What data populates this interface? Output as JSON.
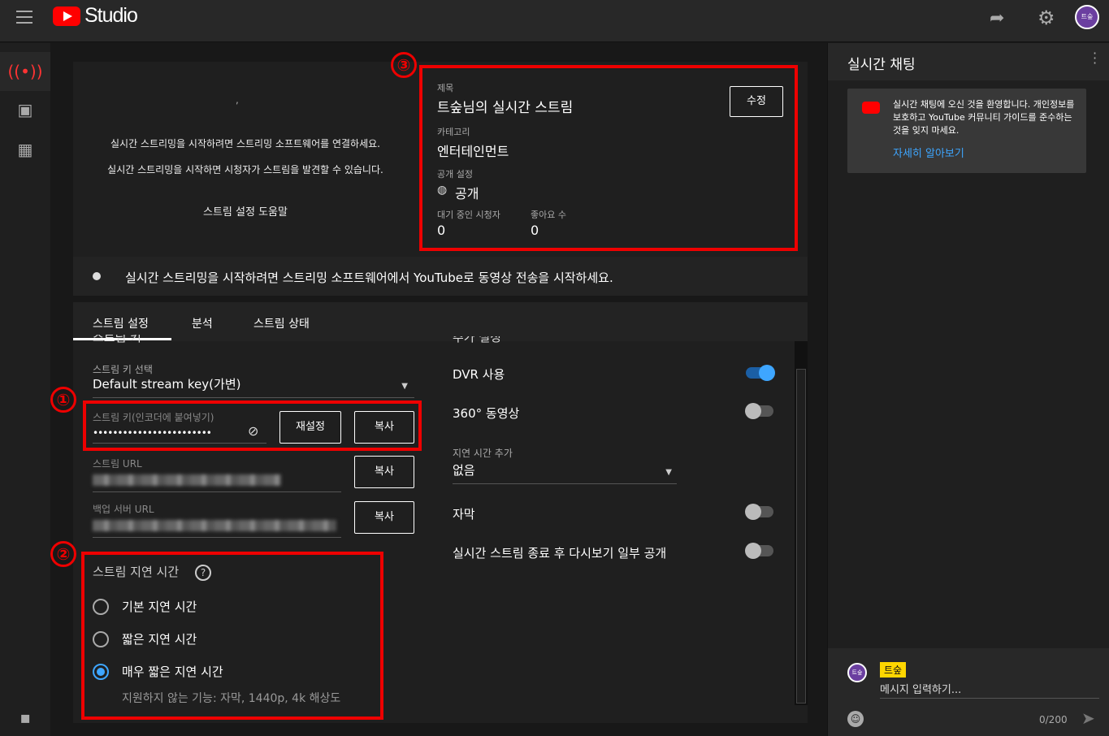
{
  "header": {
    "brand": "Studio",
    "avatar_initials": "트숲"
  },
  "preview": {
    "line1": "실시간 스트리밍을 시작하려면 스트리밍 소프트웨어를 연결하세요.",
    "line2": "실시간 스트리밍을 시작하면 시청자가 스트림을 발견할 수 있습니다.",
    "help_link": "스트림 설정 도움말"
  },
  "info": {
    "title_label": "제목",
    "title_value": "트숲님의 실시간 스트림",
    "edit_button": "수정",
    "category_label": "카테고리",
    "category_value": "엔터테인먼트",
    "visibility_label": "공개 설정",
    "visibility_value": "공개",
    "waiting_label": "대기 중인 시청자",
    "waiting_value": "0",
    "likes_label": "좋아요 수",
    "likes_value": "0"
  },
  "banner": {
    "text": "실시간 스트리밍을 시작하려면 스트리밍 소프트웨어에서 YouTube로 동영상 전송을 시작하세요."
  },
  "tabs": [
    "스트림 설정",
    "분석",
    "스트림 상태"
  ],
  "stream_key": {
    "section_cut": "스트림 키",
    "select_label": "스트림 키 선택",
    "select_value": "Default stream key(가변)",
    "key_label": "스트림 키(인코더에 붙여넣기)",
    "key_value": "••••••••••••••••••••••••",
    "reset_button": "재설정",
    "copy_button": "복사",
    "url_label": "스트림 URL",
    "backup_label": "백업 서버 URL"
  },
  "latency": {
    "title": "스트림 지연 시간",
    "options": [
      "기본 지연 시간",
      "짧은 지연 시간",
      "매우 짧은 지연 시간"
    ],
    "selected_index": 2,
    "note": "지원하지 않는 기능: 자막, 1440p, 4k 해상도"
  },
  "additional": {
    "section_cut": "추가 설정",
    "dvr": "DVR 사용",
    "dvr_on": true,
    "vr360": "360° 동영상",
    "vr360_on": false,
    "delay_label": "지연 시간 추가",
    "delay_value": "없음",
    "captions": "자막",
    "captions_on": false,
    "replay": "실시간 스트림 종료 후 다시보기 일부 공개",
    "replay_on": false
  },
  "annotations": [
    "①",
    "②",
    "③"
  ],
  "chat": {
    "title": "실시간 채팅",
    "welcome": "실시간 채팅에 오신 것을 환영합니다. 개인정보를 보호하고 YouTube 커뮤니티 가이드를 준수하는 것을 잊지 마세요.",
    "learn_more": "자세히 알아보기",
    "user_name": "트숲",
    "input_placeholder": "메시지 입력하기...",
    "counter": "0/200"
  },
  "colors": {
    "accent_blue": "#3ea6ff",
    "annotation_red": "#e00000",
    "brand_red": "#ff0000"
  }
}
